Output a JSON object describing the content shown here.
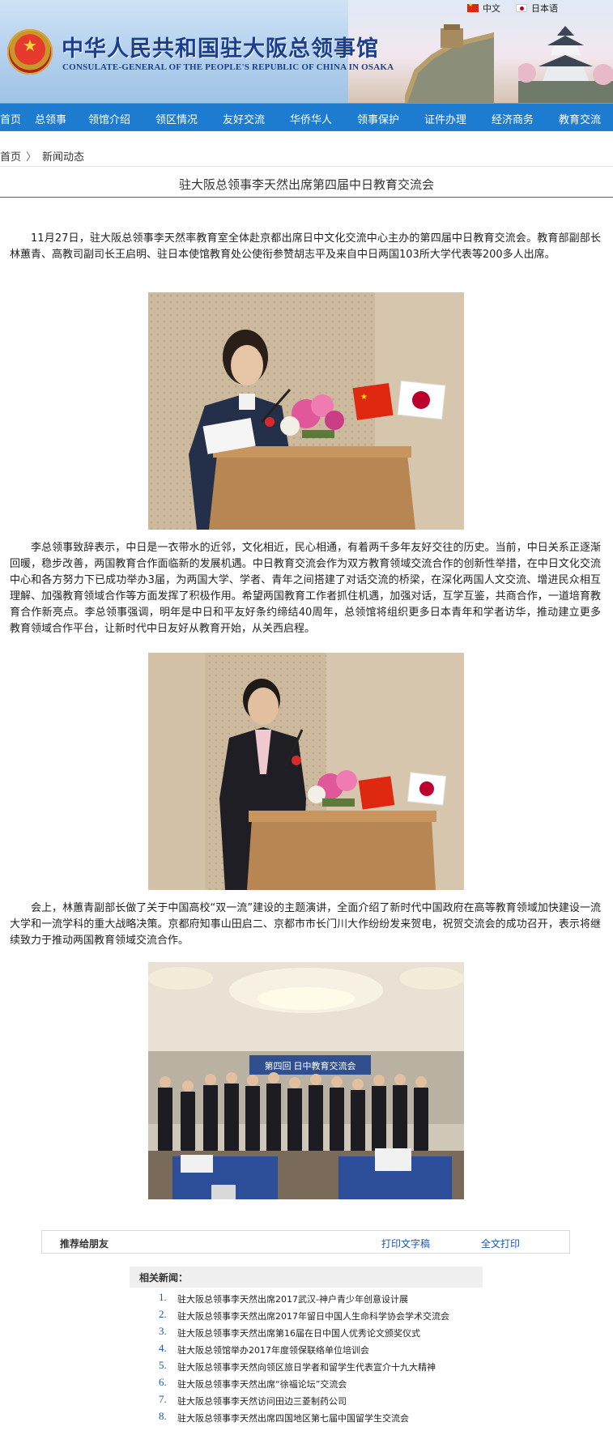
{
  "header": {
    "title_cn": "中华人民共和国驻大阪总领事馆",
    "title_en": "CONSULATE-GENERAL OF THE PEOPLE'S REPUBLIC OF CHINA IN OSAKA",
    "lang_cn": "中文",
    "lang_jp": "日本语"
  },
  "nav": {
    "items": [
      "首页",
      "总领事",
      "领馆介绍",
      "领区情况",
      "友好交流",
      "华侨华人",
      "领事保护",
      "证件办理",
      "经济商务",
      "教育交流"
    ]
  },
  "breadcrumb": {
    "home": "首页",
    "sep": "〉",
    "section": "新闻动态"
  },
  "article": {
    "title": "驻大阪总领事李天然出席第四届中日教育交流会",
    "paragraphs": [
      "11月27日，驻大阪总领事李天然率教育室全体赴京都出席日中文化交流中心主办的第四届中日教育交流会。教育部副部长林蕙青、高教司副司长王启明、驻日本使馆教育处公使衔参赞胡志平及来自中日两国103所大学代表等200多人出席。",
      "李总领事致辞表示，中日是一衣带水的近邻，文化相近，民心相通，有着两千多年友好交往的历史。当前，中日关系正逐渐回暖，稳步改善，两国教育合作面临新的发展机遇。中日教育交流会作为双方教育领域交流合作的创新性举措，在中日文化交流中心和各方努力下已成功举办3届，为两国大学、学者、青年之间搭建了对话交流的桥梁，在深化两国人文交流、增进民众相互理解、加强教育领域合作等方面发挥了积极作用。希望两国教育工作者抓住机遇，加强对话，互学互鉴，共商合作，一道培育教育合作新亮点。李总领事强调，明年是中日和平友好条约缔结40周年，总领馆将组织更多日本青年和学者访华，推动建立更多教育领域合作平台，让新时代中日友好从教育开始，从关西启程。",
      "会上，林蕙青副部长做了关于中国高校“双一流”建设的主题演讲，全面介绍了新时代中国政府在高等教育领域加快建设一流大学和一流学科的重大战略决策。京都府知事山田启二、京都市市长门川大作纷纷发来贺电，祝贺交流会的成功召开，表示将继续致力于推动两国教育领域交流合作。"
    ],
    "banner_text": "第四回 日中教育交流会"
  },
  "share": {
    "label": "推荐给朋友",
    "print_text": "打印文字稿",
    "print_full": "全文打印"
  },
  "related": {
    "heading": "相关新闻：",
    "items": [
      {
        "num": "1.",
        "title": "驻大阪总领事李天然出席2017武汉-神户青少年创意设计展"
      },
      {
        "num": "2.",
        "title": "驻大阪总领事李天然出席2017年留日中国人生命科学协会学术交流会"
      },
      {
        "num": "3.",
        "title": "驻大阪总领事李天然出席第16届在日中国人优秀论文颁奖仪式"
      },
      {
        "num": "4.",
        "title": "驻大阪总领馆举办2017年度领保联络单位培训会"
      },
      {
        "num": "5.",
        "title": "驻大阪总领事李天然向领区旅日学者和留学生代表宣介十九大精神"
      },
      {
        "num": "6.",
        "title": "驻大阪总领事李天然出席“徐福论坛”交流会"
      },
      {
        "num": "7.",
        "title": "驻大阪总领事李天然访问田边三菱制药公司"
      },
      {
        "num": "8.",
        "title": "驻大阪总领事李天然出席四国地区第七届中国留学生交流会"
      }
    ]
  }
}
